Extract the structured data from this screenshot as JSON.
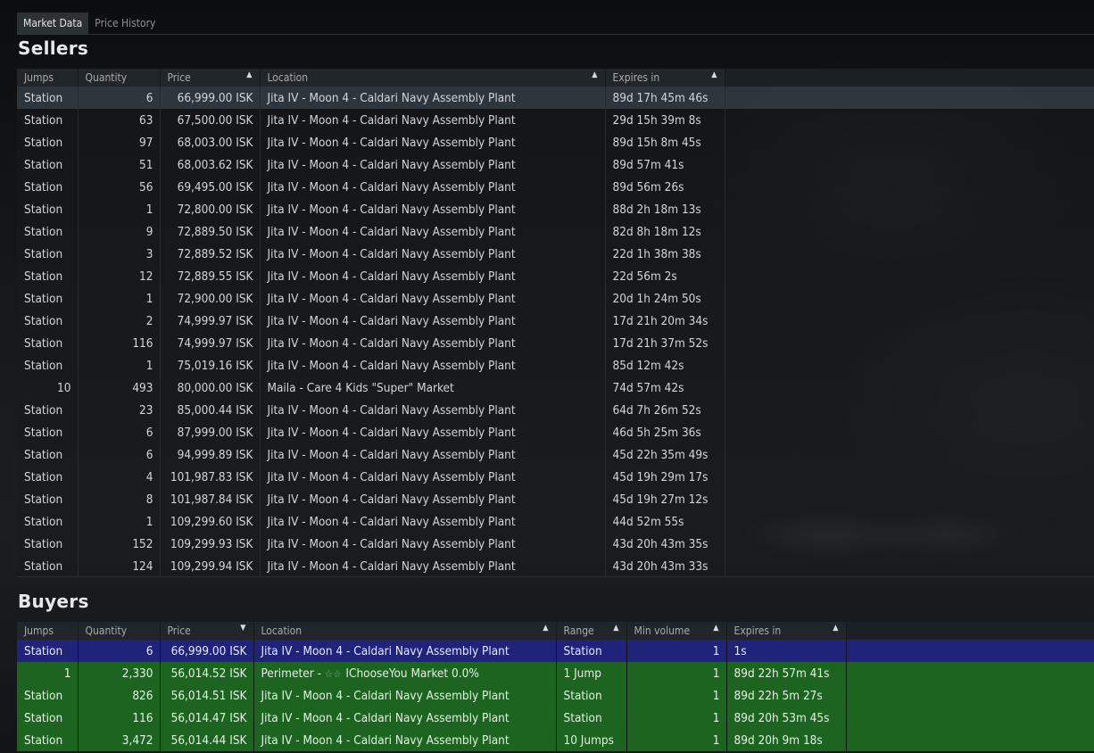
{
  "tabs": [
    "Market Data",
    "Price History"
  ],
  "sellers": {
    "title": "Sellers",
    "columns": [
      "Jumps",
      "Quantity",
      "Price",
      "Location",
      "Expires in"
    ],
    "rows": [
      [
        "Station",
        "6",
        "66,999.00 ISK",
        "Jita IV - Moon 4 - Caldari Navy Assembly Plant",
        "89d 17h 45m 46s"
      ],
      [
        "Station",
        "63",
        "67,500.00 ISK",
        "Jita IV - Moon 4 - Caldari Navy Assembly Plant",
        "29d 15h 39m 8s"
      ],
      [
        "Station",
        "97",
        "68,003.00 ISK",
        "Jita IV - Moon 4 - Caldari Navy Assembly Plant",
        "89d 15h 8m 45s"
      ],
      [
        "Station",
        "51",
        "68,003.62 ISK",
        "Jita IV - Moon 4 - Caldari Navy Assembly Plant",
        "89d 57m 41s"
      ],
      [
        "Station",
        "56",
        "69,495.00 ISK",
        "Jita IV - Moon 4 - Caldari Navy Assembly Plant",
        "89d 56m 26s"
      ],
      [
        "Station",
        "1",
        "72,800.00 ISK",
        "Jita IV - Moon 4 - Caldari Navy Assembly Plant",
        "88d 2h 18m 13s"
      ],
      [
        "Station",
        "9",
        "72,889.50 ISK",
        "Jita IV - Moon 4 - Caldari Navy Assembly Plant",
        "82d 8h 18m 12s"
      ],
      [
        "Station",
        "3",
        "72,889.52 ISK",
        "Jita IV - Moon 4 - Caldari Navy Assembly Plant",
        "22d 1h 38m 38s"
      ],
      [
        "Station",
        "12",
        "72,889.55 ISK",
        "Jita IV - Moon 4 - Caldari Navy Assembly Plant",
        "22d 56m 2s"
      ],
      [
        "Station",
        "1",
        "72,900.00 ISK",
        "Jita IV - Moon 4 - Caldari Navy Assembly Plant",
        "20d 1h 24m 50s"
      ],
      [
        "Station",
        "2",
        "74,999.97 ISK",
        "Jita IV - Moon 4 - Caldari Navy Assembly Plant",
        "17d 21h 20m 34s"
      ],
      [
        "Station",
        "116",
        "74,999.97 ISK",
        "Jita IV - Moon 4 - Caldari Navy Assembly Plant",
        "17d 21h 37m 52s"
      ],
      [
        "Station",
        "1",
        "75,019.16 ISK",
        "Jita IV - Moon 4 - Caldari Navy Assembly Plant",
        "85d 12m 42s"
      ],
      [
        "10",
        "493",
        "80,000.00 ISK",
        "Maila - Care 4 Kids \"Super\" Market",
        "74d 57m 42s"
      ],
      [
        "Station",
        "23",
        "85,000.44 ISK",
        "Jita IV - Moon 4 - Caldari Navy Assembly Plant",
        "64d 7h 26m 52s"
      ],
      [
        "Station",
        "6",
        "87,999.00 ISK",
        "Jita IV - Moon 4 - Caldari Navy Assembly Plant",
        "46d 5h 25m 36s"
      ],
      [
        "Station",
        "6",
        "94,999.89 ISK",
        "Jita IV - Moon 4 - Caldari Navy Assembly Plant",
        "45d 22h 35m 49s"
      ],
      [
        "Station",
        "4",
        "101,987.83 ISK",
        "Jita IV - Moon 4 - Caldari Navy Assembly Plant",
        "45d 19h 29m 17s"
      ],
      [
        "Station",
        "8",
        "101,987.84 ISK",
        "Jita IV - Moon 4 - Caldari Navy Assembly Plant",
        "45d 19h 27m 12s"
      ],
      [
        "Station",
        "1",
        "109,299.60 ISK",
        "Jita IV - Moon 4 - Caldari Navy Assembly Plant",
        "44d 52m 55s"
      ],
      [
        "Station",
        "152",
        "109,299.93 ISK",
        "Jita IV - Moon 4 - Caldari Navy Assembly Plant",
        "43d 20h 43m 35s"
      ],
      [
        "Station",
        "124",
        "109,299.94 ISK",
        "Jita IV - Moon 4 - Caldari Navy Assembly Plant",
        "43d 20h 43m 33s"
      ]
    ]
  },
  "buyers": {
    "title": "Buyers",
    "columns": [
      "Jumps",
      "Quantity",
      "Price",
      "Location",
      "Range",
      "Min volume",
      "Expires in"
    ],
    "stars": "☆☆",
    "rows": [
      [
        "Station",
        "6",
        "66,999.00 ISK",
        "Jita IV - Moon 4 - Caldari Navy Assembly Plant",
        "Station",
        "1",
        "1s"
      ],
      [
        "1",
        "2,330",
        "56,014.52 ISK",
        "Perimeter -  ",
        "1 Jump",
        "1",
        "89d 22h 57m 41s"
      ],
      [
        "Station",
        "826",
        "56,014.51 ISK",
        "Jita IV - Moon 4 - Caldari Navy Assembly Plant",
        "Station",
        "1",
        "89d 22h 5m 27s"
      ],
      [
        "Station",
        "116",
        "56,014.47 ISK",
        "Jita IV - Moon 4 - Caldari Navy Assembly Plant",
        "Station",
        "1",
        "89d 20h 53m 45s"
      ],
      [
        "Station",
        "3,472",
        "56,014.44 ISK",
        "Jita IV - Moon 4 - Caldari Navy Assembly Plant",
        "10 Jumps",
        "1",
        "89d 20h 9m 18s"
      ]
    ],
    "perimeter_suffix": "IChooseYou Market 0.0%"
  },
  "colors": {
    "highlight_blue": "#1f237a",
    "highlight_green": "#1d6420"
  }
}
